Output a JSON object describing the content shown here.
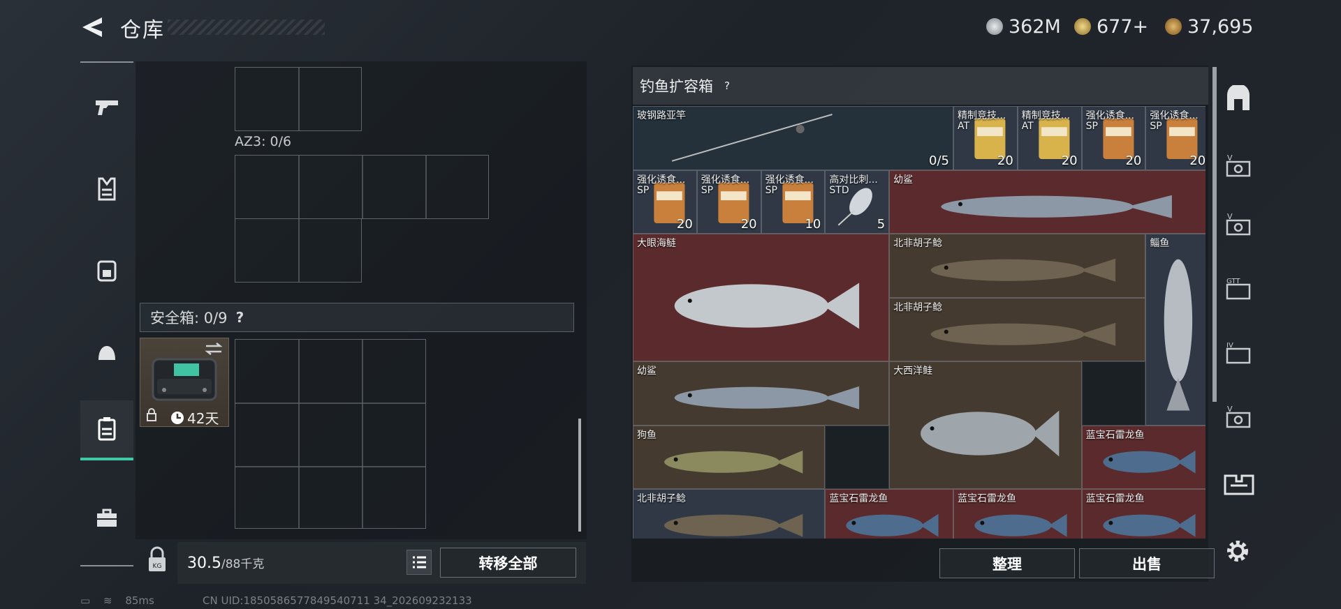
{
  "header": {
    "title": "仓库",
    "currencies": [
      {
        "icon": "silver-coin-icon",
        "value": "362M"
      },
      {
        "icon": "gold-token-icon",
        "value": "677+"
      },
      {
        "icon": "bronze-coin-icon",
        "value": "37,695"
      }
    ]
  },
  "left_nav": [
    {
      "icon": "gun-icon"
    },
    {
      "icon": "vest-icon"
    },
    {
      "icon": "backpack-icon"
    },
    {
      "icon": "helmet-icon"
    },
    {
      "icon": "container-icon",
      "active": true
    },
    {
      "icon": "briefcase-icon"
    }
  ],
  "left_panel": {
    "az3_label": "AZ3: 0/6",
    "safe_label": "安全箱: 0/9",
    "safe_help": "?",
    "safe_time": "42天",
    "weight_value": "30.5",
    "weight_max": "/88千克",
    "transfer_label": "转移全部"
  },
  "right_panel": {
    "title": "钓鱼扩容箱",
    "help": "?",
    "items": [
      {
        "name": "玻钢路亚竿",
        "sub": "",
        "count": "0/5",
        "kind": "rod"
      },
      {
        "name": "精制竞技...",
        "sub": "AT",
        "count": "20",
        "kind": "bait-yellow"
      },
      {
        "name": "精制竞技...",
        "sub": "AT",
        "count": "20",
        "kind": "bait-yellow"
      },
      {
        "name": "强化诱食...",
        "sub": "SP",
        "count": "20",
        "kind": "bait-orange"
      },
      {
        "name": "强化诱食...",
        "sub": "SP",
        "count": "20",
        "kind": "bait-orange"
      },
      {
        "name": "强化诱食...",
        "sub": "SP",
        "count": "20",
        "kind": "bait-orange"
      },
      {
        "name": "强化诱食...",
        "sub": "SP",
        "count": "20",
        "kind": "bait-orange"
      },
      {
        "name": "强化诱食...",
        "sub": "SP",
        "count": "10",
        "kind": "bait-orange"
      },
      {
        "name": "高对比刺...",
        "sub": "STD",
        "count": "5",
        "kind": "spoon-lure"
      },
      {
        "name": "幼鲨",
        "sub": "",
        "count": "",
        "kind": "shark"
      },
      {
        "name": "大眼海鲢",
        "sub": "",
        "count": "",
        "kind": "tarpon"
      },
      {
        "name": "北非胡子鲶",
        "sub": "",
        "count": "",
        "kind": "catfish"
      },
      {
        "name": "北非胡子鲶",
        "sub": "",
        "count": "",
        "kind": "catfish"
      },
      {
        "name": "鲻鱼",
        "sub": "",
        "count": "",
        "kind": "mullet"
      },
      {
        "name": "幼鲨",
        "sub": "",
        "count": "",
        "kind": "shark"
      },
      {
        "name": "大西洋鲑",
        "sub": "",
        "count": "",
        "kind": "salmon"
      },
      {
        "name": "狗鱼",
        "sub": "",
        "count": "",
        "kind": "pike"
      },
      {
        "name": "蓝宝石雷龙鱼",
        "sub": "",
        "count": "",
        "kind": "snakehead"
      },
      {
        "name": "北非胡子鲶",
        "sub": "",
        "count": "",
        "kind": "catfish"
      },
      {
        "name": "蓝宝石雷龙鱼",
        "sub": "",
        "count": "",
        "kind": "snakehead"
      },
      {
        "name": "蓝宝石雷龙鱼",
        "sub": "",
        "count": "",
        "kind": "snakehead"
      },
      {
        "name": "蓝宝石雷龙鱼",
        "sub": "",
        "count": "",
        "kind": "snakehead"
      }
    ],
    "sort_label": "整理",
    "sell_label": "出售"
  },
  "right_rail": [
    "exit-icon",
    "voucher-icon",
    "voucher-icon",
    "gtt-ticket-icon",
    "iv-ticket-icon",
    "voucher-icon",
    "kit-icon"
  ],
  "status": {
    "ping": "85ms",
    "uid": "CN UID:1850586577849540711 34_202609232133"
  },
  "colors": {
    "accent": "#3ec9a7",
    "rare_red": "#5b2a2c",
    "uncommon_brown": "#443a30",
    "common_blue": "#2f3844"
  }
}
